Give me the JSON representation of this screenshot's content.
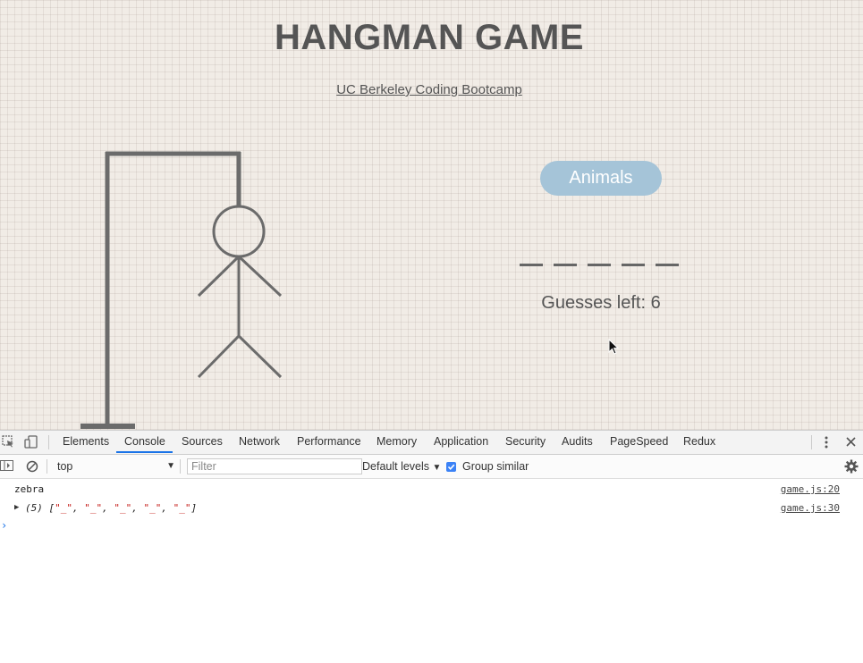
{
  "game": {
    "title": "HANGMAN GAME",
    "subtitle_link": "UC Berkeley Coding Bootcamp",
    "category_button": "Animals",
    "blanks": [
      "_",
      "_",
      "_",
      "_",
      "_"
    ],
    "guesses_label": "Guesses left:",
    "guesses_left": "6"
  },
  "devtools": {
    "tabs": [
      "Elements",
      "Console",
      "Sources",
      "Network",
      "Performance",
      "Memory",
      "Application",
      "Security",
      "Audits",
      "PageSpeed",
      "Redux"
    ],
    "active_tab": "Console",
    "context": "top",
    "filter_placeholder": "Filter",
    "levels_label": "Default levels",
    "group_similar_label": "Group similar",
    "group_similar_checked": true,
    "logs": [
      {
        "text": "zebra",
        "source": "game.js:20"
      },
      {
        "count": "(5)",
        "items": [
          "\"_\"",
          "\"_\"",
          "\"_\"",
          "\"_\"",
          "\"_\""
        ],
        "source": "game.js:30"
      }
    ]
  },
  "colors": {
    "page_bg": "#f1ece6",
    "drawing": "#6b6b6b",
    "button_bg": "#a5c4d8",
    "accent": "#1a73e8",
    "string": "#c41a16"
  },
  "icons": [
    "inspect-icon",
    "device-toggle-icon",
    "more-icon",
    "close-icon",
    "sidebar-toggle-icon",
    "clear-console-icon",
    "settings-icon",
    "checkbox-checked-icon",
    "mouse-cursor-icon"
  ]
}
